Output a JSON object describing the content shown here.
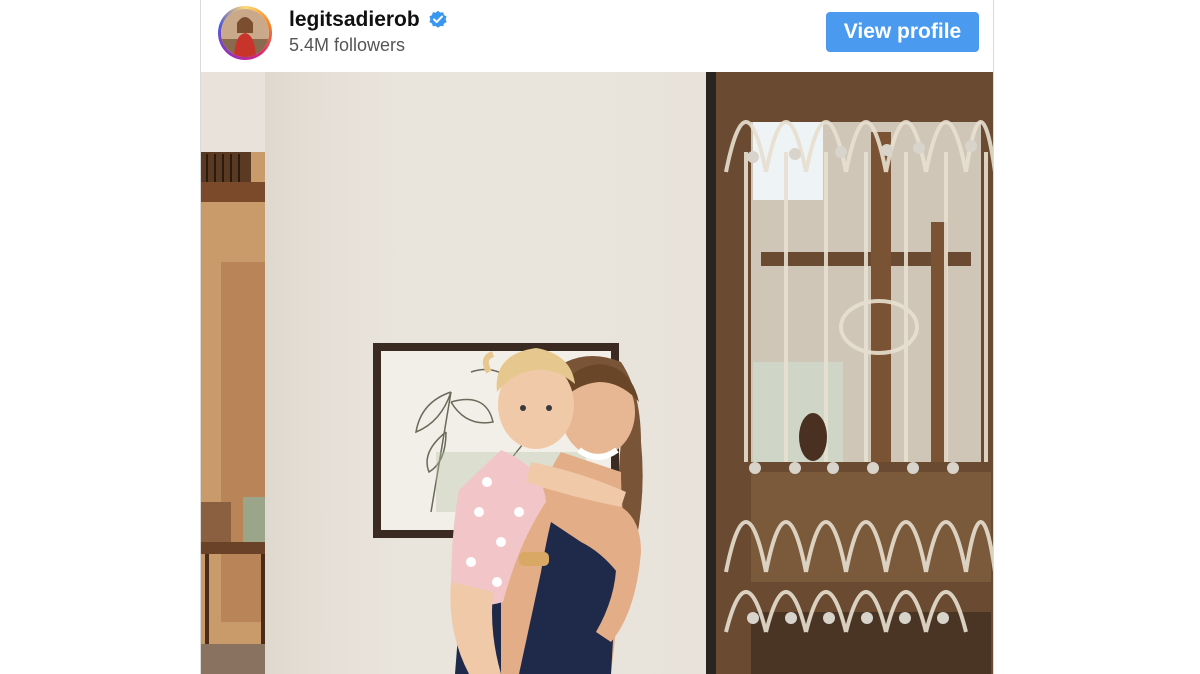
{
  "profile": {
    "username": "legitsadierob",
    "followers": "5.4M followers",
    "verified": true,
    "avatar_icon": "profile-avatar"
  },
  "actions": {
    "view_profile_label": "View profile"
  },
  "post": {
    "media_icon": "photo-mother-holding-toddler"
  },
  "colors": {
    "button": "#4a9bf0",
    "verified_badge": "#3897f0"
  }
}
